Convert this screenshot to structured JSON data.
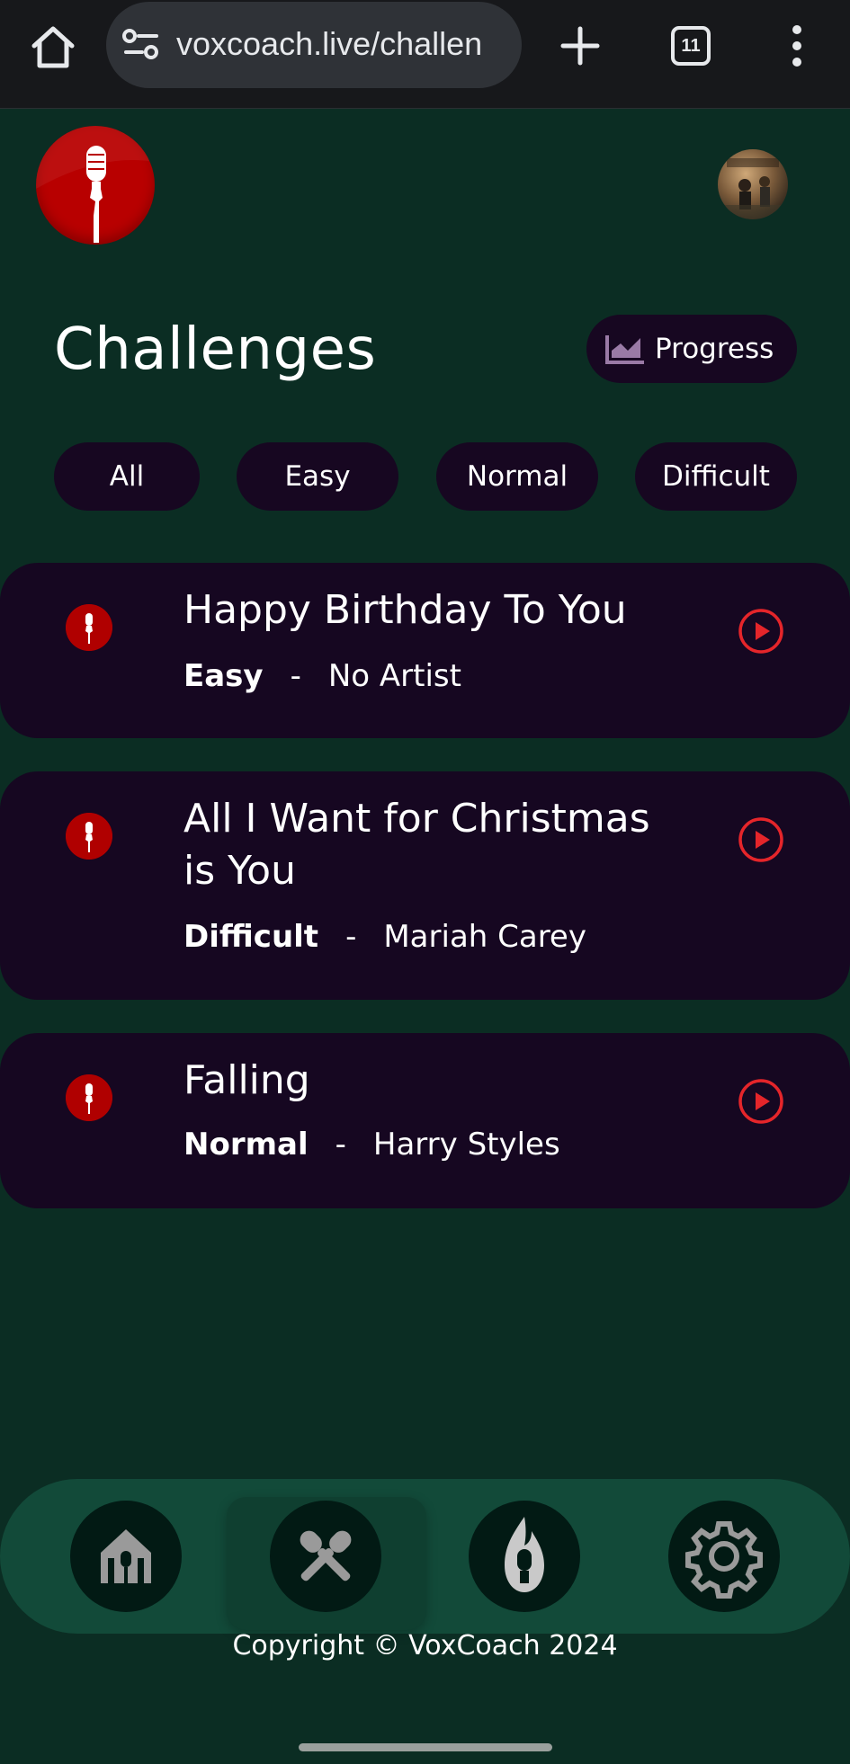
{
  "browser": {
    "url": "voxcoach.live/challen",
    "tab_count": "11"
  },
  "page": {
    "title": "Challenges",
    "progress_label": "Progress"
  },
  "filters": [
    {
      "label": "All"
    },
    {
      "label": "Easy"
    },
    {
      "label": "Normal"
    },
    {
      "label": "Difficult"
    }
  ],
  "challenges": [
    {
      "title": "Happy Birthday To You",
      "difficulty": "Easy",
      "separator": "-",
      "artist": "No Artist"
    },
    {
      "title": "All I Want for Christmas is You",
      "difficulty": "Difficult",
      "separator": "-",
      "artist": "Mariah Carey"
    },
    {
      "title": "Falling",
      "difficulty": "Normal",
      "separator": "-",
      "artist": "Harry Styles"
    }
  ],
  "nav": [
    {
      "icon": "home-mic-icon"
    },
    {
      "icon": "crossed-mics-icon",
      "active": true
    },
    {
      "icon": "flame-mic-icon"
    },
    {
      "icon": "gear-icon"
    }
  ],
  "footer": {
    "copyright": "Copyright © VoxCoach 2024"
  },
  "colors": {
    "background": "#0b2d23",
    "card": "#160721",
    "accent_red": "#e5252a",
    "nav_bar": "#124a39"
  }
}
